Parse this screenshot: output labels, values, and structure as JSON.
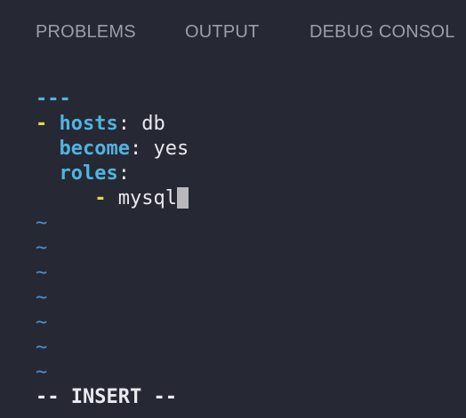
{
  "panel": {
    "tabs": [
      {
        "label": "PROBLEMS"
      },
      {
        "label": "OUTPUT"
      },
      {
        "label": "DEBUG CONSOL"
      }
    ]
  },
  "editor": {
    "doc_start": "---",
    "line1": {
      "dash": "-",
      "key": "hosts",
      "colon": ":",
      "value": "db"
    },
    "line2": {
      "key": "become",
      "colon": ":",
      "value": "yes"
    },
    "line3": {
      "key": "roles",
      "colon": ":"
    },
    "line4": {
      "dash": "-",
      "value": "mysql"
    },
    "tilde": "~",
    "mode": "-- INSERT --"
  },
  "colors": {
    "background": "#262833",
    "key": "#4fb4df",
    "dash": "#e4d94c",
    "tilde": "#4a8fd3",
    "text": "#e9e9ef",
    "tab_text": "#9b9ea8"
  }
}
